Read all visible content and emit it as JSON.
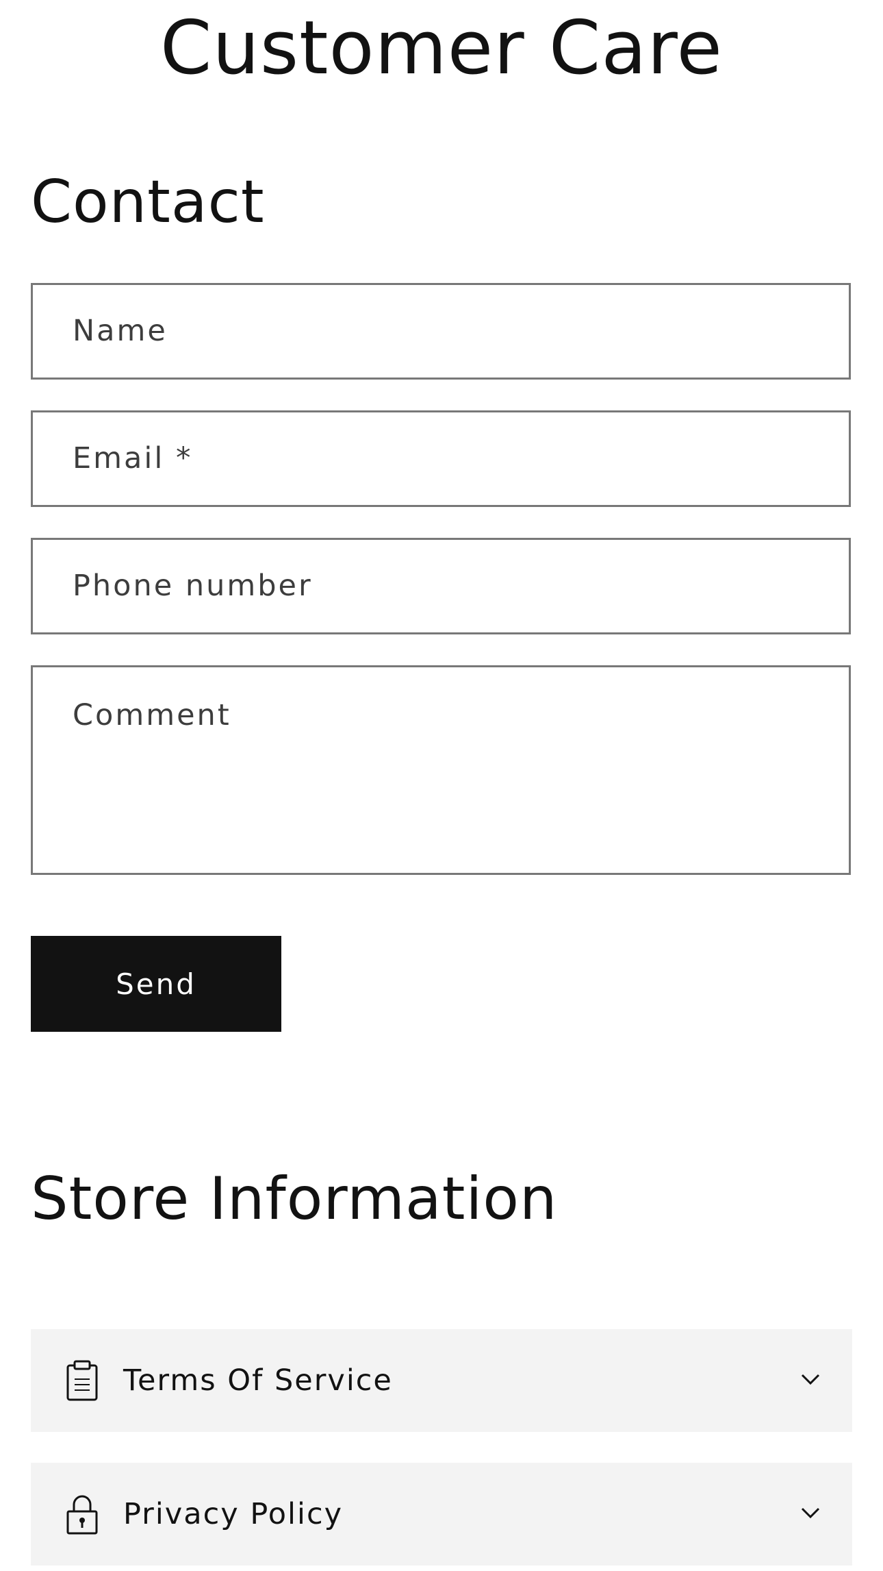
{
  "page": {
    "title": "Customer Care"
  },
  "contact": {
    "heading": "Contact",
    "fields": {
      "name_placeholder": "Name",
      "email_placeholder": "Email *",
      "phone_placeholder": "Phone number",
      "comment_placeholder": "Comment"
    },
    "send_label": "Send"
  },
  "store_info": {
    "heading": "Store Information",
    "items": [
      {
        "label": "Terms Of Service",
        "icon": "clipboard-icon"
      },
      {
        "label": "Privacy Policy",
        "icon": "lock-icon"
      }
    ]
  },
  "colors": {
    "text": "#121212",
    "button_bg": "#121212",
    "field_border": "#787878",
    "accordion_bg": "#f3f3f3"
  }
}
